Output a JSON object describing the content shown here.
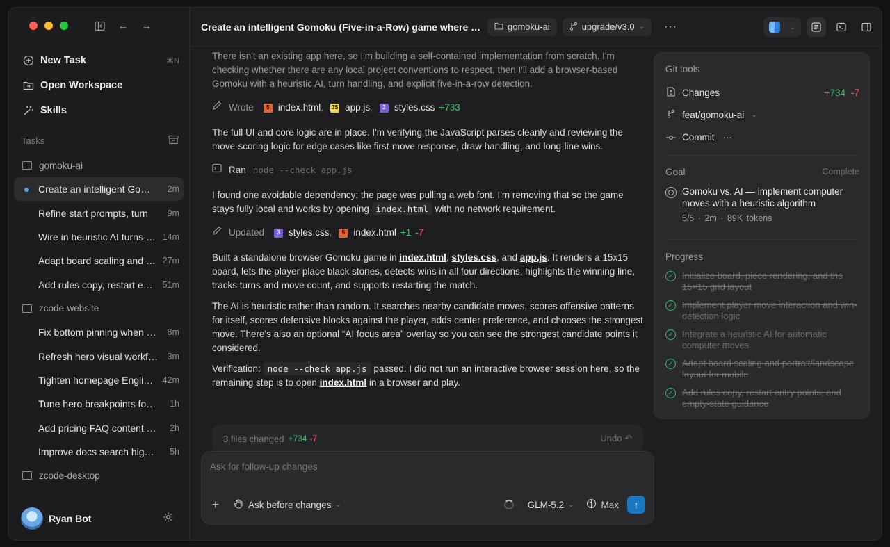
{
  "sidebar": {
    "nav": [
      {
        "label": "New Task",
        "shortcut": "⌘N"
      },
      {
        "label": "Open Workspace"
      },
      {
        "label": "Skills"
      }
    ],
    "tasks_label": "Tasks",
    "groups": [
      {
        "name": "gomoku-ai",
        "tasks": [
          {
            "label": "Create an intelligent Gomoku",
            "time": "2m"
          },
          {
            "label": "Refine start prompts, turn",
            "time": "9m"
          },
          {
            "label": "Wire in heuristic AI turns and",
            "time": "14m"
          },
          {
            "label": "Adapt board scaling and layout",
            "time": "27m"
          },
          {
            "label": "Add rules copy, restart entry",
            "time": "51m"
          }
        ]
      },
      {
        "name": "zcode-website",
        "tasks": [
          {
            "label": "Fix bottom pinning when scroll",
            "time": "8m"
          },
          {
            "label": "Refresh hero visual workflow",
            "time": "3m"
          },
          {
            "label": "Tighten homepage English copy",
            "time": "42m"
          },
          {
            "label": "Tune hero breakpoints for mobile",
            "time": "1h"
          },
          {
            "label": "Add pricing FAQ content and",
            "time": "2h"
          },
          {
            "label": "Improve docs search highlighting",
            "time": "5h"
          }
        ]
      },
      {
        "name": "zcode-desktop",
        "tasks": []
      }
    ],
    "user": {
      "name": "Ryan Bot"
    }
  },
  "topbar": {
    "title": "Create an intelligent Gomoku (Five-in-a-Row) game where the ...",
    "workspace": "gomoku-ai",
    "branch": "upgrade/v3.0"
  },
  "chat": {
    "intro": "There isn't an existing app here, so I'm building a self-contained implementation from scratch. I'm checking whether there are any local project conventions to respect, then I'll add a browser-based Gomoku with a heuristic AI, turn handling, and explicit five-in-a-row detection.",
    "wrote": {
      "label": "Wrote",
      "files": [
        "index.html",
        "app.js",
        "styles.css"
      ],
      "add": "+733"
    },
    "p2": "The full UI and core logic are in place. I'm verifying the JavaScript parses cleanly and reviewing the move-scoring logic for edge cases like first-move response, draw handling, and long-line wins.",
    "ran": {
      "label": "Ran",
      "cmd": "node --check app.js"
    },
    "p3a": "I found one avoidable dependency: the page was pulling a web font. I'm removing that so the game stays fully local and works by opening",
    "p3code": "index.html",
    "p3b": "with no network requirement.",
    "updated": {
      "label": "Updated",
      "files": [
        "styles.css",
        "index.html"
      ],
      "add": "+1",
      "del": "-7"
    },
    "p4a": "Built a standalone browser Gomoku game in",
    "p4f1": "index.html",
    "p4f2": "styles.css",
    "p4f3": "app.js",
    "p4b": "It renders a 15x15 board, lets the player place black stones, detects wins in all four directions, highlights the winning line, tracks turns and move count, and supports restarting the match.",
    "p5": "The AI is heuristic rather than random. It searches nearby candidate moves, scores offensive patterns for itself, scores defensive blocks against the player, adds center preference, and chooses the strongest move. There's also an optional “AI focus area” overlay so you can see the strongest candidate points it considered.",
    "p6a": "Verification:",
    "p6code": "node --check app.js",
    "p6b": "passed. I did not run an interactive browser session here, so the remaining step is to open",
    "p6link": "index.html",
    "p6c": "in a browser and play.",
    "files_changed": "3 files changed",
    "fc_add": "+734",
    "fc_del": "-7",
    "undo": "Undo"
  },
  "composer": {
    "placeholder": "Ask for follow-up changes",
    "mode": "Ask before changes",
    "model": "GLM-5.2",
    "effort": "Max"
  },
  "panel": {
    "git_title": "Git tools",
    "changes_label": "Changes",
    "changes_add": "+734",
    "changes_del": "-7",
    "branch": "feat/gomoku-ai",
    "commit_label": "Commit",
    "goal_title": "Goal",
    "goal_status": "Complete",
    "goal_text": "Gomoku vs. AI — implement computer moves with a heuristic algorithm",
    "goal_meta": "5/5 · 2m · 89K tokens",
    "progress_title": "Progress",
    "progress": [
      "Initialize board, piece rendering, and the 15×15 grid layout",
      "Implement player move interaction and win-detection logic",
      "Integrate a heuristic AI for automatic computer moves",
      "Adapt board scaling and portrait/landscape layout for mobile",
      "Add rules copy, restart entry points, and empty-state guidance"
    ]
  },
  "colors": {
    "accent": "#1a78c2",
    "add": "#33c36b",
    "del": "#ff5c5c"
  }
}
